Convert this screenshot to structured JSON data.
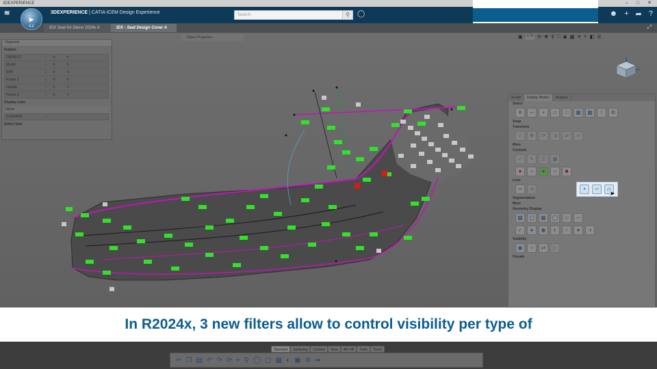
{
  "os_bar": {
    "app_name": "3DEXPERIENCE"
  },
  "topbar": {
    "brand_strong": "3DEXPERIENCE",
    "brand_rest": " | CATIA ICEM Design Experience",
    "search_placeholder": "Search",
    "compass_version": "6.0"
  },
  "tabs": [
    {
      "label": "IDX Seat for Demo 2024x A"
    },
    {
      "label": "IDX - Seat Design Cover A"
    }
  ],
  "object_properties_label": "Object Properties",
  "organizer": {
    "title": "Organizer",
    "frames_label": "Frames",
    "rows": [
      {
        "name": "DEFAULT"
      },
      {
        "name": "Model"
      },
      {
        "name": "SHP"
      },
      {
        "name": "Frame 1"
      },
      {
        "name": "Handle"
      },
      {
        "name": "Frame 2"
      }
    ],
    "display_lists_label": "Display Lists",
    "name_placeholder": "Name",
    "display_row": "SUSHAPE",
    "select_sets_label": "Select Sets"
  },
  "view_toolbar": {
    "zoom": "0.74"
  },
  "cmdpanel": {
    "tabs": [
      "Sculpt",
      "Display Modes",
      "Analyse"
    ],
    "sections": [
      "Select",
      "Snap",
      "Transform",
      "More",
      "Controls",
      "Lens",
      "Segmentation",
      "More",
      "Geometry Display",
      "Visibility",
      "Visuals"
    ]
  },
  "action_bar": {
    "tabs": [
      "Standard",
      "Surfacing",
      "Content",
      "View",
      "AR-VR",
      "Tools",
      "Touch"
    ]
  },
  "subtitle": "In R2024x, 3 new filters allow to control visibility per type of",
  "colors": {
    "brand_blue": "#0b5d90",
    "topbar": "#0e3a58",
    "label_green": "#33e02b",
    "curve_magenta": "#c015b8"
  }
}
